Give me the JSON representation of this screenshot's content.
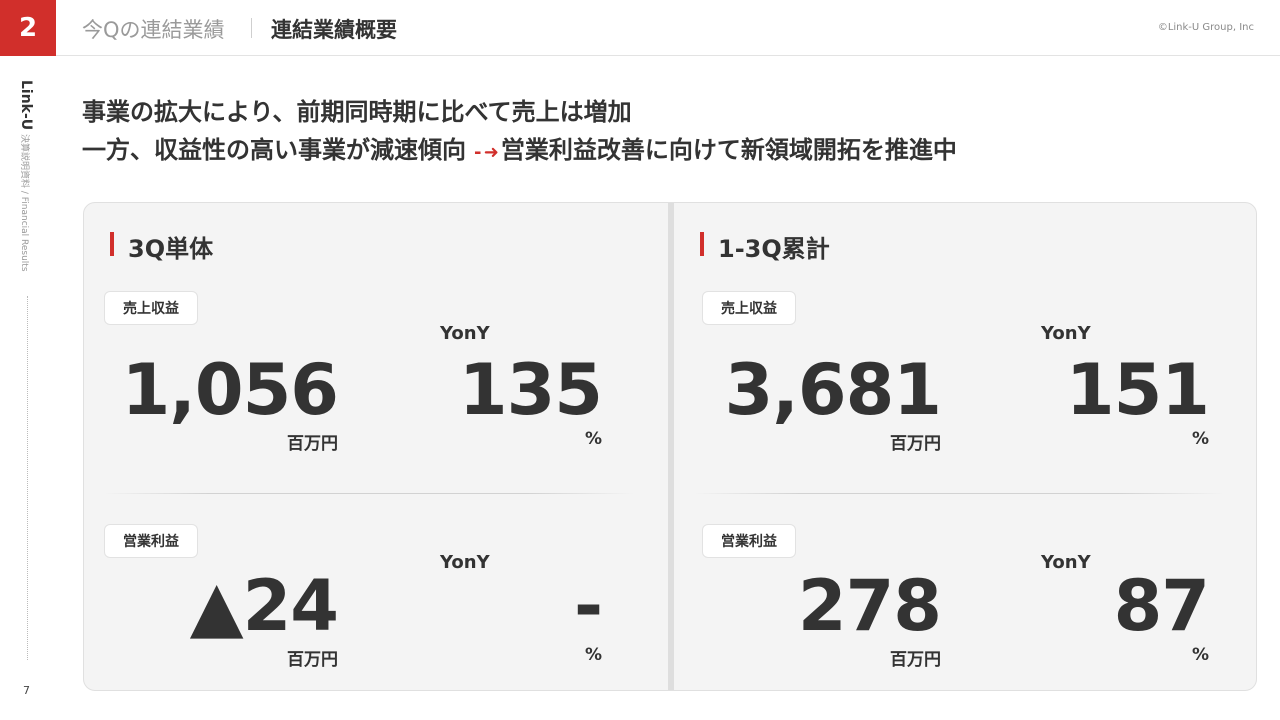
{
  "header": {
    "page_number": "2",
    "section_title": "今Qの連結業績",
    "sub_title": "連結業績概要",
    "copyright": "©Link-U Group, Inc"
  },
  "sidebar": {
    "brand": "Link-U",
    "sub": "決算説明資料 / Financial Results"
  },
  "footer": {
    "page": "7"
  },
  "headline": {
    "line1": "事業の拡大により、前期同時期に比べて売上は増加",
    "line2_left": "一方、収益性の高い事業が減速傾向",
    "arrow": "- ➜",
    "line2_right": "営業利益改善に向けて新領域開拓を推進中"
  },
  "columns": [
    {
      "title": "3Q単体",
      "revenue": {
        "tag": "売上収益",
        "value": "1,056",
        "unit": "百万円",
        "yony_label": "YonY",
        "yony_value": "135",
        "yony_unit": "%"
      },
      "op_profit": {
        "tag": "営業利益",
        "value": "▲24",
        "unit": "百万円",
        "yony_label": "YonY",
        "yony_value": "-",
        "yony_unit": "%"
      }
    },
    {
      "title": "1-3Q累計",
      "revenue": {
        "tag": "売上収益",
        "value": "3,681",
        "unit": "百万円",
        "yony_label": "YonY",
        "yony_value": "151",
        "yony_unit": "%"
      },
      "op_profit": {
        "tag": "営業利益",
        "value": "278",
        "unit": "百万円",
        "yony_label": "YonY",
        "yony_value": "87",
        "yony_unit": "%"
      }
    }
  ],
  "colors": {
    "accent": "#d12f2b",
    "panel_bg": "#f4f4f4",
    "text": "#333333"
  }
}
